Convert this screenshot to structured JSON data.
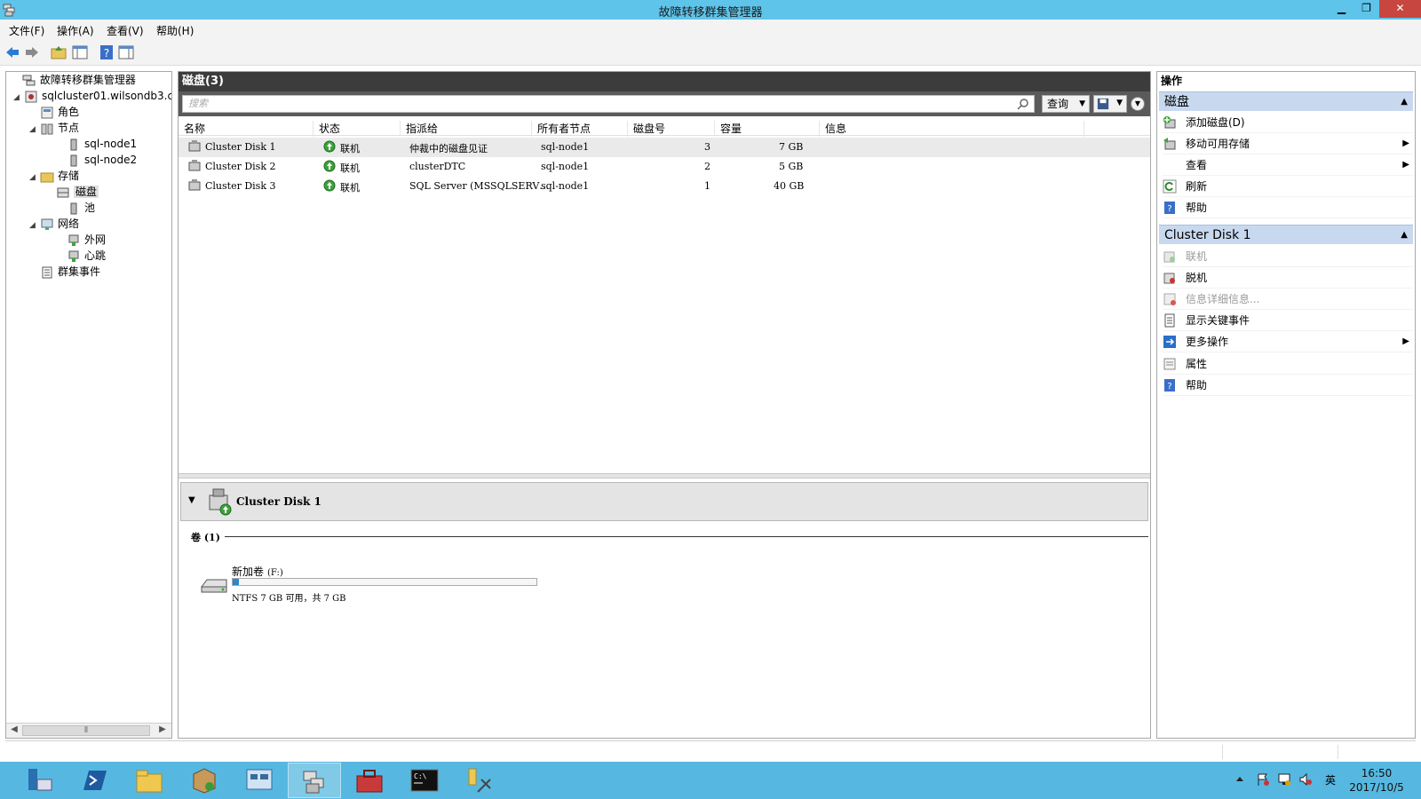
{
  "window": {
    "title": "故障转移群集管理器",
    "min": "▁",
    "max": "❐",
    "close": "✕"
  },
  "menu": [
    "文件(F)",
    "操作(A)",
    "查看(V)",
    "帮助(H)"
  ],
  "tree": {
    "root": "故障转移群集管理器",
    "cluster": "sqlcluster01.wilsondb3.com",
    "roles": "角色",
    "nodes": "节点",
    "node1": "sql-node1",
    "node2": "sql-node2",
    "storage": "存储",
    "disks": "磁盘",
    "pools": "池",
    "networks": "网络",
    "net_external": "外网",
    "net_heartbeat": "心跳",
    "cluster_events": "群集事件"
  },
  "center": {
    "header": "磁盘(3)",
    "search_placeholder": "搜索",
    "query_label": "查询",
    "columns": [
      "名称",
      "状态",
      "指派给",
      "所有者节点",
      "磁盘号",
      "容量",
      "信息"
    ],
    "rows": [
      {
        "name": "Cluster Disk 1",
        "status": "联机",
        "assigned": "仲裁中的磁盘见证",
        "owner": "sql-node1",
        "disk_no": "3",
        "capacity": "7 GB"
      },
      {
        "name": "Cluster Disk 2",
        "status": "联机",
        "assigned": "clusterDTC",
        "owner": "sql-node1",
        "disk_no": "2",
        "capacity": "5 GB"
      },
      {
        "name": "Cluster Disk 3",
        "status": "联机",
        "assigned": "SQL Server (MSSQLSERV…",
        "owner": "sql-node1",
        "disk_no": "1",
        "capacity": "40 GB"
      }
    ],
    "detail": {
      "name": "Cluster Disk 1",
      "volumes_label": "卷 (1)",
      "volume_name": "新加卷",
      "volume_letter": "(F:)",
      "volume_info": "NTFS 7 GB 可用，共 7 GB",
      "used_fraction": 0.02
    }
  },
  "actions": {
    "title": "操作",
    "section1": "磁盘",
    "items1": [
      "添加磁盘(D)",
      "移动可用存储",
      "查看",
      "刷新",
      "帮助"
    ],
    "section2": "Cluster Disk 1",
    "items2": [
      "联机",
      "脱机",
      "信息详细信息...",
      "显示关键事件",
      "更多操作",
      "属性",
      "帮助"
    ]
  },
  "clock": {
    "time": "16:50",
    "date": "2017/10/5"
  },
  "tray": {
    "ime": "英"
  },
  "colors": {
    "titlebar": "#5fc4ea",
    "taskbar": "#56b8e0",
    "section": "#c8d9ef",
    "close": "#c7463f"
  }
}
